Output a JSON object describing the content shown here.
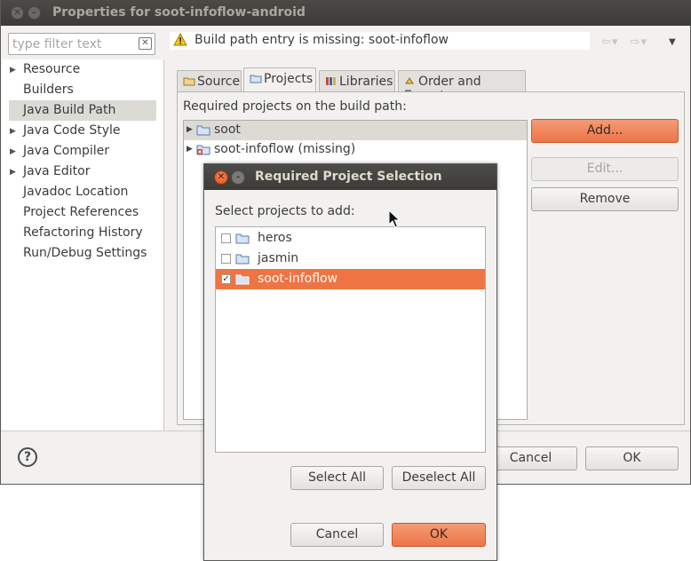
{
  "window": {
    "title": "Properties for soot-infoflow-android",
    "close_glyph": "✕",
    "min_glyph": "–"
  },
  "filter": {
    "placeholder": "type filter text",
    "value": ""
  },
  "nav": {
    "items": [
      {
        "label": "Resource",
        "expandable": true
      },
      {
        "label": "Builders",
        "expandable": false
      },
      {
        "label": "Java Build Path",
        "expandable": false,
        "selected": true
      },
      {
        "label": "Java Code Style",
        "expandable": true
      },
      {
        "label": "Java Compiler",
        "expandable": true
      },
      {
        "label": "Java Editor",
        "expandable": true
      },
      {
        "label": "Javadoc Location",
        "expandable": false
      },
      {
        "label": "Project References",
        "expandable": false
      },
      {
        "label": "Refactoring History",
        "expandable": false
      },
      {
        "label": "Run/Debug Settings",
        "expandable": false
      }
    ]
  },
  "message": {
    "text": "Build path entry is missing: soot-infoflow"
  },
  "tabs": [
    {
      "label": "Source",
      "active": false
    },
    {
      "label": "Projects",
      "active": true
    },
    {
      "label": "Libraries",
      "active": false
    },
    {
      "label": "Order and Export",
      "active": false
    }
  ],
  "projects_tab": {
    "label": "Required projects on the build path:",
    "projects": [
      {
        "label": "soot",
        "selected": true
      },
      {
        "label": "soot-infoflow (missing)",
        "selected": false
      }
    ],
    "buttons": {
      "add": "Add...",
      "edit": "Edit...",
      "remove": "Remove"
    }
  },
  "footer": {
    "help": "?",
    "cancel": "Cancel",
    "ok": "OK"
  },
  "dialog": {
    "title": "Required Project Selection",
    "label": "Select projects to add:",
    "projects": [
      {
        "label": "heros",
        "checked": false
      },
      {
        "label": "jasmin",
        "checked": false
      },
      {
        "label": "soot-infoflow",
        "checked": true,
        "selected": true
      }
    ],
    "select_all": "Select All",
    "deselect_all": "Deselect All",
    "cancel": "Cancel",
    "ok": "OK"
  },
  "colors": {
    "accent": "#ee7444",
    "titlebar": "#3c3b37",
    "window_bg": "#f2f1f0",
    "selection": "#dcdad5"
  }
}
